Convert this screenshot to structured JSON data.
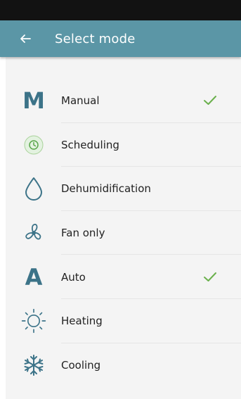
{
  "header": {
    "back_icon": "arrow-left-icon",
    "title": "Select mode"
  },
  "colors": {
    "status_bar": "#121212",
    "app_bar": "#5b96a6",
    "icon": "#3c7388",
    "check": "#6ab04c",
    "background": "#f4f4f4"
  },
  "modes": [
    {
      "label": "Manual",
      "icon": "M",
      "selected": true
    },
    {
      "label": "Scheduling",
      "icon": "clock-circle-icon",
      "selected": false
    },
    {
      "label": "Dehumidification",
      "icon": "water-drop-icon",
      "selected": false
    },
    {
      "label": "Fan only",
      "icon": "fan-icon",
      "selected": false
    },
    {
      "label": "Auto",
      "icon": "A",
      "selected": true
    },
    {
      "label": "Heating",
      "icon": "sun-icon",
      "selected": false
    },
    {
      "label": "Cooling",
      "icon": "snowflake-icon",
      "selected": false
    }
  ]
}
